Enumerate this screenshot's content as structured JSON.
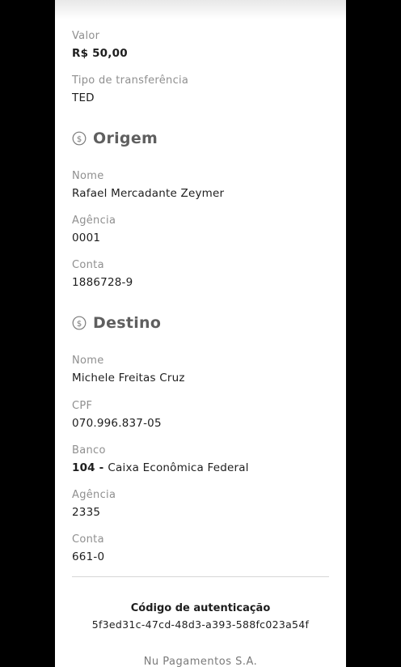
{
  "valor": {
    "label": "Valor",
    "value": "R$ 50,00"
  },
  "tipo": {
    "label": "Tipo de transferência",
    "value": "TED"
  },
  "origem": {
    "title": "Origem",
    "icon": "money-icon",
    "nome": {
      "label": "Nome",
      "value": "Rafael Mercadante Zeymer"
    },
    "agencia": {
      "label": "Agência",
      "value": "0001"
    },
    "conta": {
      "label": "Conta",
      "value": "1886728-9"
    }
  },
  "destino": {
    "title": "Destino",
    "icon": "money-icon",
    "nome": {
      "label": "Nome",
      "value": "Michele Freitas Cruz"
    },
    "cpf": {
      "label": "CPF",
      "value": "070.996.837-05"
    },
    "banco": {
      "label": "Banco",
      "code": "104",
      "separator": " - ",
      "name": "Caixa Econômica Federal"
    },
    "agencia": {
      "label": "Agência",
      "value": "2335"
    },
    "conta": {
      "label": "Conta",
      "value": "661-0"
    }
  },
  "autenticacao": {
    "title": "Código de autenticação",
    "code": "5f3ed31c-47cd-48d3-a393-588fc023a54f"
  },
  "footer": {
    "company": "Nu Pagamentos S.A."
  },
  "colors": {
    "background": "#000000",
    "card": "#ffffff",
    "label": "#8f8f8f",
    "section": "#5f5f5f"
  }
}
